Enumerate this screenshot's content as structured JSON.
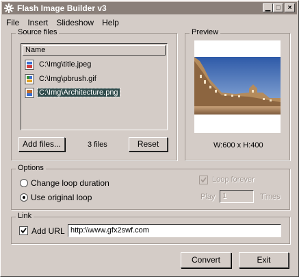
{
  "window": {
    "title": "Flash Image Builder v3"
  },
  "menu": [
    "File",
    "Insert",
    "Slideshow",
    "Help"
  ],
  "source_files": {
    "legend": "Source files",
    "column_header": "Name",
    "files": [
      {
        "name": "C:\\Img\\title.jpeg",
        "icon": "jpeg-file-icon"
      },
      {
        "name": "C:\\Img\\pbrush.gif",
        "icon": "gif-file-icon"
      },
      {
        "name": "C:\\Img\\Architecture.png",
        "icon": "png-file-icon",
        "selected": true
      }
    ],
    "add_button": "Add files...",
    "count": "3 files",
    "reset_button": "Reset"
  },
  "preview": {
    "legend": "Preview",
    "dimensions": "W:600 x H:400"
  },
  "options": {
    "legend": "Options",
    "radio_change_loop": "Change loop duration",
    "radio_original_loop": "Use original loop",
    "selected_radio": "Use original loop",
    "loop_forever": "Loop forever",
    "loop_forever_checked": true,
    "play_label": "Play",
    "play_value": "1",
    "times_label": "Times"
  },
  "link": {
    "legend": "Link",
    "add_url_label": "Add URL",
    "add_url_checked": true,
    "url": "http:\\\\www.gfx2swf.com"
  },
  "actions": {
    "convert": "Convert",
    "exit": "Exit"
  },
  "colors": {
    "titlebar": "#8a7f79",
    "window": "#d4ccc7",
    "selection": "#2f4b4b"
  }
}
